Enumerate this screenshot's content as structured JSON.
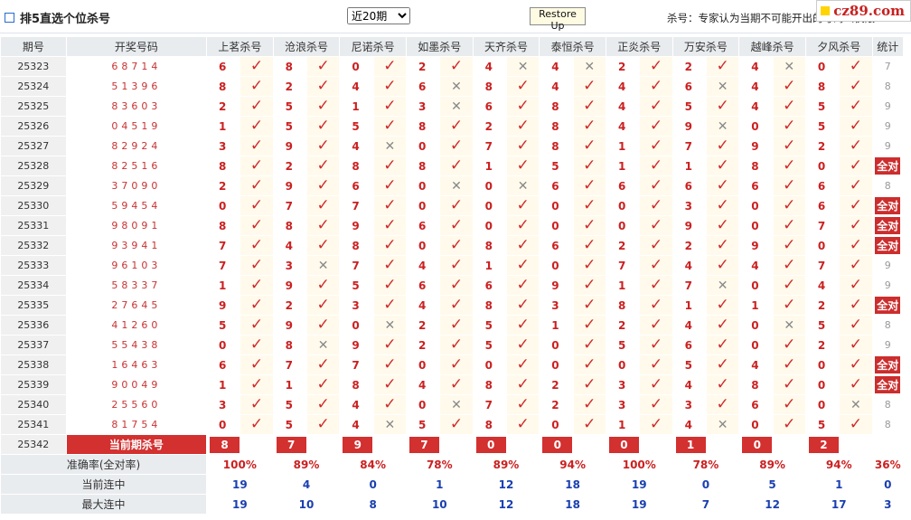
{
  "title": "排5直选个位杀号",
  "period_select": {
    "value": "近20期",
    "options": [
      "近20期"
    ]
  },
  "restore_button": "Restore Up",
  "note": "杀号：专家认为当期不可能开出的号码（仅限…",
  "logo": "cz89.com",
  "headers": {
    "issue": "期号",
    "numbers": "开奖号码",
    "stat": "统计"
  },
  "experts": [
    "上茗杀号",
    "沧浪杀号",
    "尼诺杀号",
    "如墨杀号",
    "天齐杀号",
    "泰恒杀号",
    "正炎杀号",
    "万安杀号",
    "越峰杀号",
    "夕风杀号"
  ],
  "icons": {
    "hit": "check-icon",
    "miss": "cross-icon"
  },
  "colors": {
    "accent": "#d33030",
    "hit": "#d02a2a",
    "blue": "#1a3fb0"
  },
  "rows": [
    {
      "issue": "25323",
      "numbers": "68714",
      "values": [
        "6",
        "8",
        "0",
        "2",
        "4",
        "4",
        "2",
        "2",
        "4",
        "0"
      ],
      "hits": [
        1,
        1,
        1,
        1,
        0,
        0,
        1,
        1,
        0,
        1
      ],
      "stat": "7"
    },
    {
      "issue": "25324",
      "numbers": "51396",
      "values": [
        "8",
        "2",
        "4",
        "6",
        "8",
        "4",
        "4",
        "6",
        "4",
        "8"
      ],
      "hits": [
        1,
        1,
        1,
        0,
        1,
        1,
        1,
        0,
        1,
        1
      ],
      "stat": "8"
    },
    {
      "issue": "25325",
      "numbers": "83603",
      "values": [
        "2",
        "5",
        "1",
        "3",
        "6",
        "8",
        "4",
        "5",
        "4",
        "5"
      ],
      "hits": [
        1,
        1,
        1,
        0,
        1,
        1,
        1,
        1,
        1,
        1
      ],
      "stat": "9"
    },
    {
      "issue": "25326",
      "numbers": "04519",
      "values": [
        "1",
        "5",
        "5",
        "8",
        "2",
        "8",
        "4",
        "9",
        "0",
        "5"
      ],
      "hits": [
        1,
        1,
        1,
        1,
        1,
        1,
        1,
        0,
        1,
        1
      ],
      "stat": "9"
    },
    {
      "issue": "25327",
      "numbers": "82924",
      "values": [
        "3",
        "9",
        "4",
        "0",
        "7",
        "8",
        "1",
        "7",
        "9",
        "2"
      ],
      "hits": [
        1,
        1,
        0,
        1,
        1,
        1,
        1,
        1,
        1,
        1
      ],
      "stat": "9"
    },
    {
      "issue": "25328",
      "numbers": "82516",
      "values": [
        "8",
        "2",
        "8",
        "8",
        "1",
        "5",
        "1",
        "1",
        "8",
        "0"
      ],
      "hits": [
        1,
        1,
        1,
        1,
        1,
        1,
        1,
        1,
        1,
        1
      ],
      "stat": "全对"
    },
    {
      "issue": "25329",
      "numbers": "37090",
      "values": [
        "2",
        "9",
        "6",
        "0",
        "0",
        "6",
        "6",
        "6",
        "6",
        "6"
      ],
      "hits": [
        1,
        1,
        1,
        0,
        0,
        1,
        1,
        1,
        1,
        1
      ],
      "stat": "8"
    },
    {
      "issue": "25330",
      "numbers": "59454",
      "values": [
        "0",
        "7",
        "7",
        "0",
        "0",
        "0",
        "0",
        "3",
        "0",
        "6"
      ],
      "hits": [
        1,
        1,
        1,
        1,
        1,
        1,
        1,
        1,
        1,
        1
      ],
      "stat": "全对"
    },
    {
      "issue": "25331",
      "numbers": "98091",
      "values": [
        "8",
        "8",
        "9",
        "6",
        "0",
        "0",
        "0",
        "9",
        "0",
        "7"
      ],
      "hits": [
        1,
        1,
        1,
        1,
        1,
        1,
        1,
        1,
        1,
        1
      ],
      "stat": "全对"
    },
    {
      "issue": "25332",
      "numbers": "93941",
      "values": [
        "7",
        "4",
        "8",
        "0",
        "8",
        "6",
        "2",
        "2",
        "9",
        "0"
      ],
      "hits": [
        1,
        1,
        1,
        1,
        1,
        1,
        1,
        1,
        1,
        1
      ],
      "stat": "全对"
    },
    {
      "issue": "25333",
      "numbers": "96103",
      "values": [
        "7",
        "3",
        "7",
        "4",
        "1",
        "0",
        "7",
        "4",
        "4",
        "7"
      ],
      "hits": [
        1,
        0,
        1,
        1,
        1,
        1,
        1,
        1,
        1,
        1
      ],
      "stat": "9"
    },
    {
      "issue": "25334",
      "numbers": "58337",
      "values": [
        "1",
        "9",
        "5",
        "6",
        "6",
        "9",
        "1",
        "7",
        "0",
        "4"
      ],
      "hits": [
        1,
        1,
        1,
        1,
        1,
        1,
        1,
        0,
        1,
        1
      ],
      "stat": "9"
    },
    {
      "issue": "25335",
      "numbers": "27645",
      "values": [
        "9",
        "2",
        "3",
        "4",
        "8",
        "3",
        "8",
        "1",
        "1",
        "2"
      ],
      "hits": [
        1,
        1,
        1,
        1,
        1,
        1,
        1,
        1,
        1,
        1
      ],
      "stat": "全对"
    },
    {
      "issue": "25336",
      "numbers": "41260",
      "values": [
        "5",
        "9",
        "0",
        "2",
        "5",
        "1",
        "2",
        "4",
        "0",
        "5"
      ],
      "hits": [
        1,
        1,
        0,
        1,
        1,
        1,
        1,
        1,
        0,
        1
      ],
      "stat": "8"
    },
    {
      "issue": "25337",
      "numbers": "55438",
      "values": [
        "0",
        "8",
        "9",
        "2",
        "5",
        "0",
        "5",
        "6",
        "0",
        "2"
      ],
      "hits": [
        1,
        0,
        1,
        1,
        1,
        1,
        1,
        1,
        1,
        1
      ],
      "stat": "9"
    },
    {
      "issue": "25338",
      "numbers": "16463",
      "values": [
        "6",
        "7",
        "7",
        "0",
        "0",
        "0",
        "0",
        "5",
        "4",
        "0"
      ],
      "hits": [
        1,
        1,
        1,
        1,
        1,
        1,
        1,
        1,
        1,
        1
      ],
      "stat": "全对"
    },
    {
      "issue": "25339",
      "numbers": "90049",
      "values": [
        "1",
        "1",
        "8",
        "4",
        "8",
        "2",
        "3",
        "4",
        "8",
        "0"
      ],
      "hits": [
        1,
        1,
        1,
        1,
        1,
        1,
        1,
        1,
        1,
        1
      ],
      "stat": "全对"
    },
    {
      "issue": "25340",
      "numbers": "25560",
      "values": [
        "3",
        "5",
        "4",
        "0",
        "7",
        "2",
        "3",
        "3",
        "6",
        "0"
      ],
      "hits": [
        1,
        1,
        1,
        0,
        1,
        1,
        1,
        1,
        1,
        0
      ],
      "stat": "8"
    },
    {
      "issue": "25341",
      "numbers": "81754",
      "values": [
        "0",
        "5",
        "4",
        "5",
        "8",
        "0",
        "1",
        "4",
        "0",
        "5"
      ],
      "hits": [
        1,
        1,
        0,
        1,
        1,
        1,
        1,
        0,
        1,
        1
      ],
      "stat": "8"
    }
  ],
  "current": {
    "issue": "25342",
    "label": "当前期杀号",
    "values": [
      "8",
      "7",
      "9",
      "7",
      "0",
      "0",
      "0",
      "1",
      "0",
      "2"
    ]
  },
  "summary": {
    "accuracy": {
      "label": "准确率(全对率)",
      "values": [
        "100%",
        "89%",
        "84%",
        "78%",
        "89%",
        "94%",
        "100%",
        "78%",
        "89%",
        "94%"
      ],
      "total": "36%"
    },
    "current_streak": {
      "label": "当前连中",
      "values": [
        "19",
        "4",
        "0",
        "1",
        "12",
        "18",
        "19",
        "0",
        "5",
        "1"
      ],
      "total": "0"
    },
    "max_streak": {
      "label": "最大连中",
      "values": [
        "19",
        "10",
        "8",
        "10",
        "12",
        "18",
        "19",
        "7",
        "12",
        "17"
      ],
      "total": "3"
    }
  }
}
